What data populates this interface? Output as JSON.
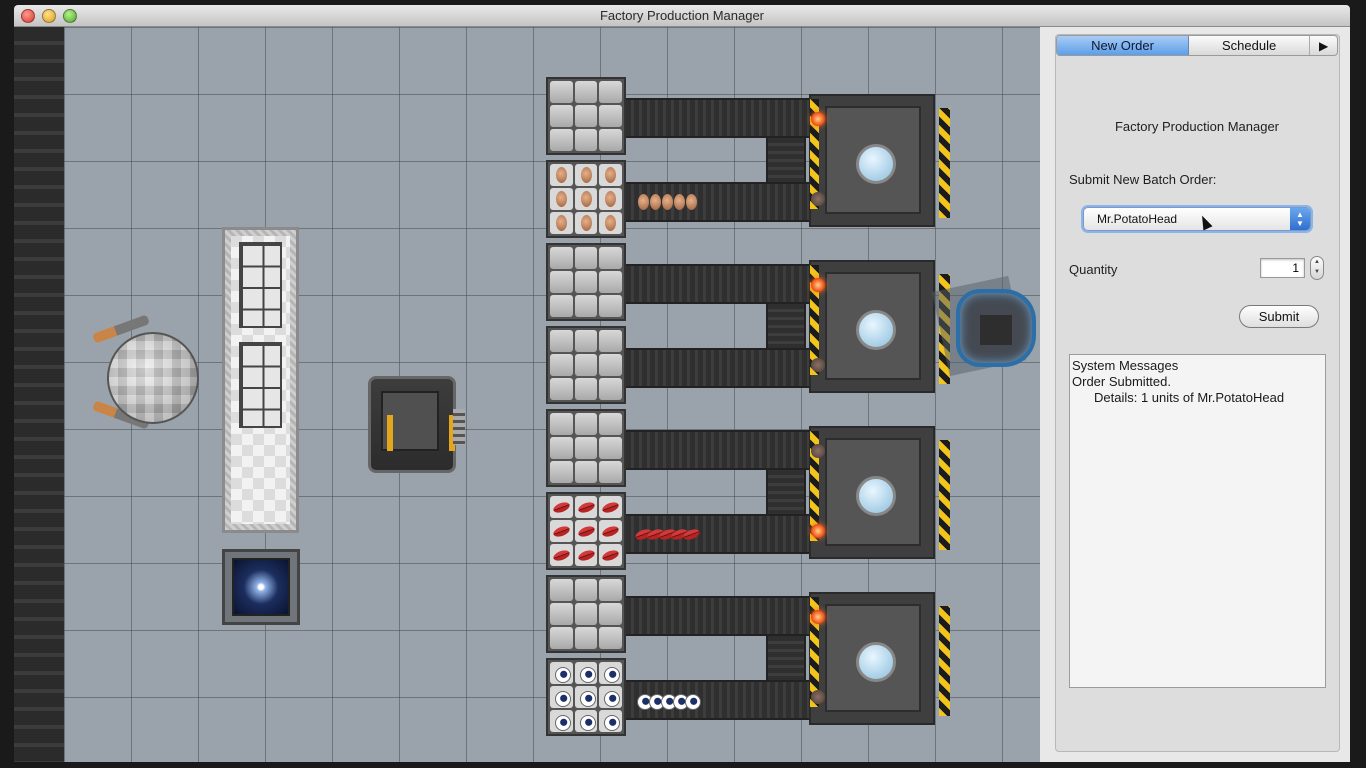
{
  "window": {
    "title": "Factory Production Manager"
  },
  "panel": {
    "tabs": [
      {
        "label": "New Order",
        "selected": true
      },
      {
        "label": "Schedule",
        "selected": false
      }
    ],
    "more_tabs_glyph": "▶",
    "heading": "Factory Production Manager",
    "batch_order_label": "Submit New Batch Order:",
    "product_select": {
      "value": "Mr.PotatoHead"
    },
    "quantity_label": "Quantity",
    "quantity_value": "1",
    "submit_label": "Submit",
    "messages": {
      "title": "System Messages",
      "lines": [
        "Order Submitted.",
        "Details: 1 units of Mr.PotatoHead"
      ]
    }
  },
  "colors": {
    "floor": "#9aa3ab",
    "selected_tab": "#5d9ee8",
    "hazard_yellow": "#f1c51c",
    "lamp_on": "#f0561a",
    "robot_ring": "#2c6fa8"
  },
  "factory": {
    "bins": [
      "empty",
      "ears",
      "empty",
      "empty",
      "empty",
      "lips",
      "empty",
      "eyes"
    ],
    "lines": [
      {
        "lamp_top": "on",
        "lamp_bottom": "off",
        "moving_part": "ears"
      },
      {
        "lamp_top": "on",
        "lamp_bottom": "off",
        "moving_part": "none"
      },
      {
        "lamp_top": "off",
        "lamp_bottom": "on",
        "moving_part": "lips"
      },
      {
        "lamp_top": "on",
        "lamp_bottom": "off",
        "moving_part": "eyes"
      }
    ]
  }
}
